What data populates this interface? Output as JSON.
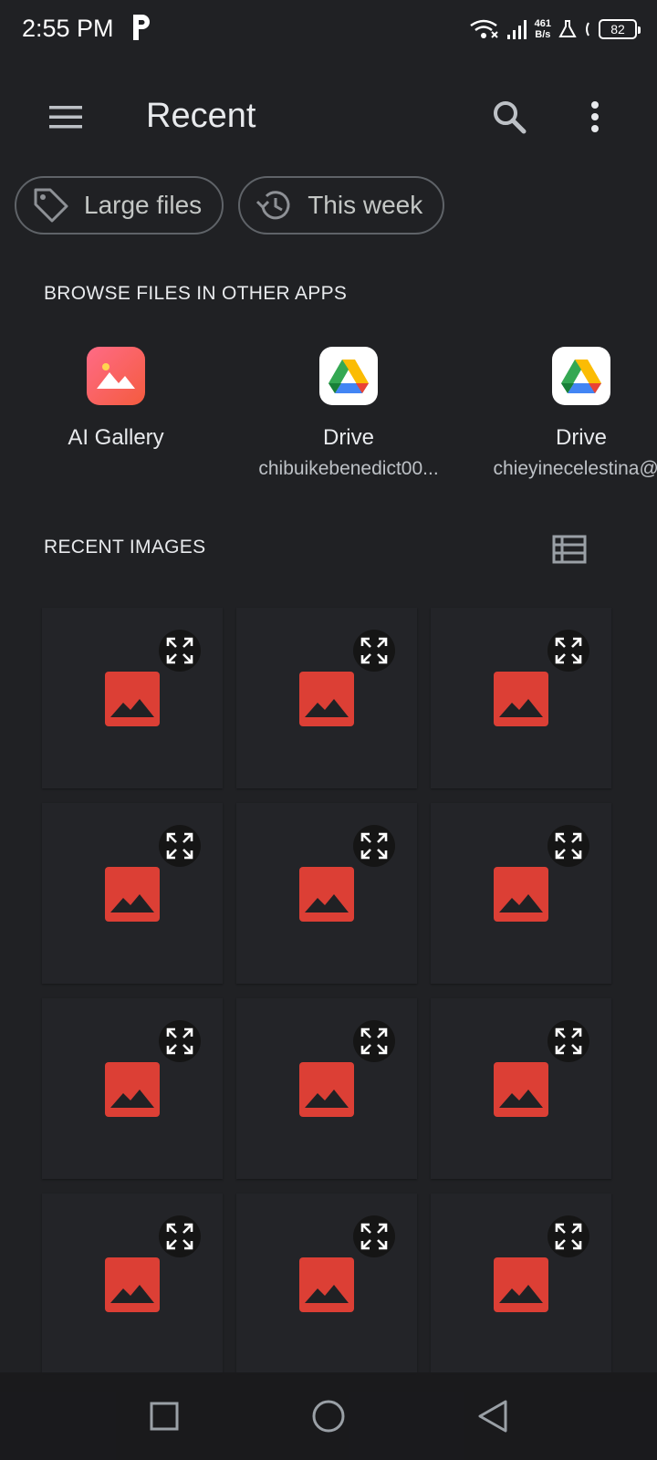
{
  "status_bar": {
    "time": "2:55 PM",
    "net_speed_value": "461",
    "net_speed_unit": "B/s",
    "battery": "82"
  },
  "app_bar": {
    "title": "Recent",
    "icons": [
      "menu-icon",
      "search-icon",
      "more-vert-icon"
    ]
  },
  "chips": [
    {
      "label": "Large files",
      "icon": "tag-icon"
    },
    {
      "label": "This week",
      "icon": "history-icon"
    }
  ],
  "browse_section": {
    "title": "BROWSE FILES IN OTHER APPS",
    "apps": [
      {
        "name": "AI Gallery",
        "account": "",
        "icon": "gallery-icon"
      },
      {
        "name": "Drive",
        "account": "chibuikebenedict00...",
        "icon": "google-drive-icon"
      },
      {
        "name": "Drive",
        "account": "chieyinecelestina@g",
        "icon": "google-drive-icon"
      }
    ]
  },
  "recent_images": {
    "title": "RECENT IMAGES",
    "view_toggle_icon": "list-view-icon",
    "thumbnails": 12
  },
  "colors": {
    "background": "#202124",
    "thumbnail_placeholder": "#dc3f35",
    "gallery_icon": "#f55a6b"
  },
  "nav_bar": {
    "icons": [
      "recents-icon",
      "home-icon",
      "back-icon"
    ]
  }
}
